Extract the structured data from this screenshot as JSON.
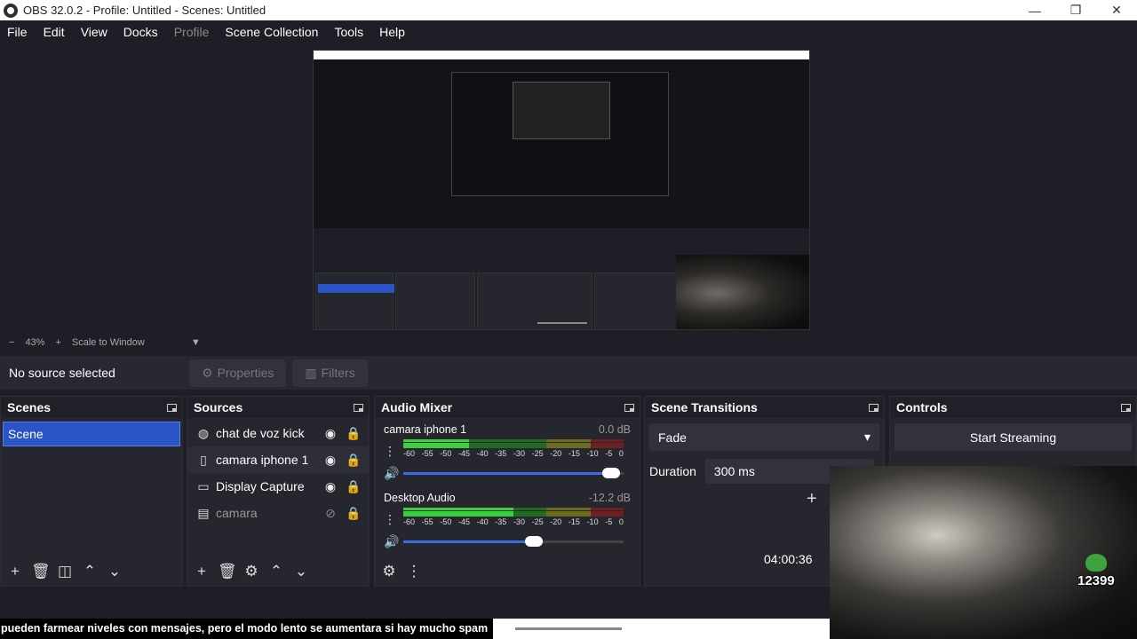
{
  "window": {
    "title": "OBS 32.0.2 - Profile: Untitled - Scenes: Untitled"
  },
  "menu": [
    "File",
    "Edit",
    "View",
    "Docks",
    "Profile",
    "Scene Collection",
    "Tools",
    "Help"
  ],
  "zoom": {
    "minus": "−",
    "level": "43%",
    "plus": "+",
    "mode": "Scale to Window"
  },
  "props": {
    "no_source": "No source selected",
    "properties": "Properties",
    "filters": "Filters"
  },
  "scenes": {
    "title": "Scenes",
    "items": [
      "Scene"
    ]
  },
  "sources": {
    "title": "Sources",
    "items": [
      {
        "name": "chat de voz kick",
        "icon": "browser-icon"
      },
      {
        "name": "camara iphone 1",
        "icon": "file-icon"
      },
      {
        "name": "Display Capture",
        "icon": "monitor-icon"
      },
      {
        "name": "camara",
        "icon": "window-icon"
      }
    ]
  },
  "mixer": {
    "title": "Audio Mixer",
    "channels": [
      {
        "name": "camara iphone 1",
        "db": "0.0 dB",
        "level": 0.3,
        "volume": 0.95
      },
      {
        "name": "Desktop Audio",
        "db": "-12.2 dB",
        "level": 0.5,
        "volume": 0.6
      }
    ],
    "ticks": [
      "-60",
      "-55",
      "-50",
      "-45",
      "-40",
      "-35",
      "-30",
      "-25",
      "-20",
      "-15",
      "-10",
      "-5",
      "0"
    ]
  },
  "transitions": {
    "title": "Scene Transitions",
    "type": "Fade",
    "duration_label": "Duration",
    "duration_value": "300 ms"
  },
  "controls": {
    "title": "Controls",
    "start_streaming": "Start Streaming"
  },
  "status": {
    "timer": "04:00:36"
  },
  "overlay": {
    "caption": "pueden farmear niveles con mensajes, pero el modo lento se aumentara si hay mucho spam",
    "count": "12399"
  }
}
